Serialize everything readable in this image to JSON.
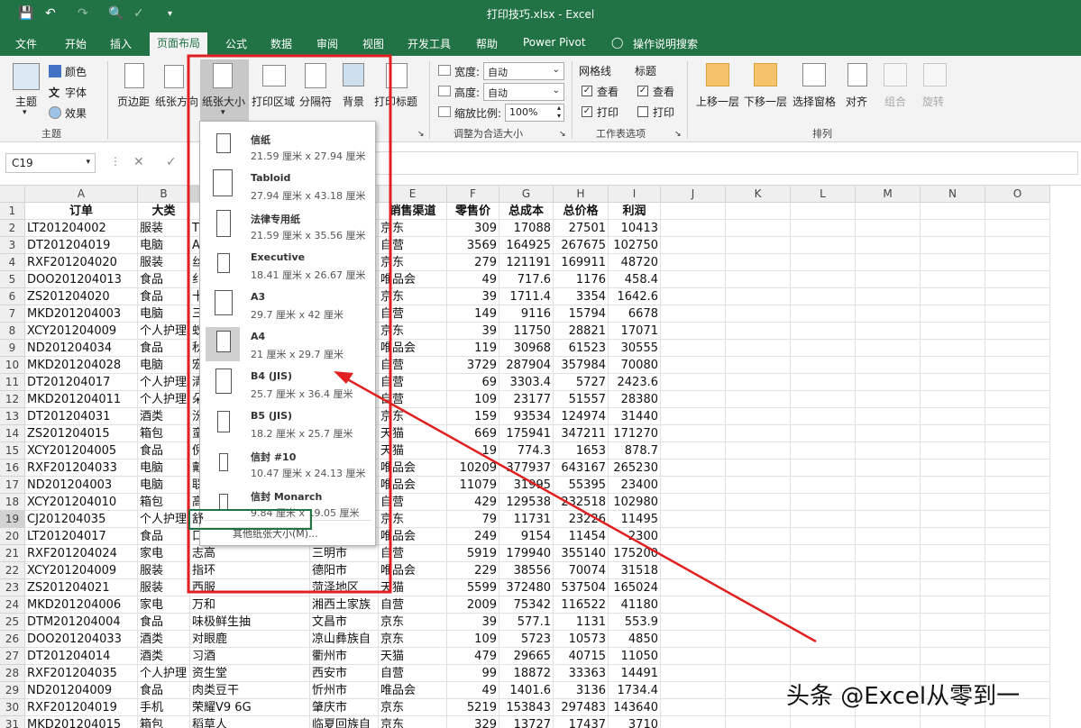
{
  "title_bar": {
    "doc_title": "打印技巧.xlsx",
    "app_name": "Excel",
    "separator": " - "
  },
  "tabs": [
    "文件",
    "开始",
    "插入",
    "页面布局",
    "公式",
    "数据",
    "审阅",
    "视图",
    "开发工具",
    "帮助",
    "Power Pivot",
    "操作说明搜索"
  ],
  "active_tab": "页面布局",
  "ribbon": {
    "theme": {
      "main": "主题",
      "colors": "颜色",
      "fonts": "字体",
      "effects": "效果",
      "group": "主题"
    },
    "page_setup": {
      "margins": "页边距",
      "orientation": "纸张方向",
      "size": "纸张大小",
      "print_area": "打印区域",
      "breaks": "分隔符",
      "background": "背景",
      "print_titles": "打印标题"
    },
    "scale": {
      "width_label": "宽度:",
      "width_value": "自动",
      "height_label": "高度:",
      "height_value": "自动",
      "scale_label": "缩放比例:",
      "scale_value": "100%",
      "group": "调整为合适大小"
    },
    "sheet_options": {
      "gridlines": "网格线",
      "headings": "标题",
      "view": "查看",
      "print": "打印",
      "group": "工作表选项",
      "grid_view": true,
      "grid_print": true,
      "head_view": true,
      "head_print": false
    },
    "arrange": {
      "forward": "上移一层",
      "backward": "下移一层",
      "selection_pane": "选择窗格",
      "align": "对齐",
      "group_btn": "组合",
      "rotate": "旋转",
      "group": "排列"
    }
  },
  "formula_bar": {
    "name_box": "C19",
    "cancel": "✕",
    "enter": "✓"
  },
  "columns": [
    "A",
    "B",
    "C",
    "D",
    "E",
    "F",
    "G",
    "H",
    "I",
    "J",
    "K",
    "L",
    "M",
    "N",
    "O"
  ],
  "rows": [
    [
      "订单",
      "大类",
      "",
      "",
      "销售渠道",
      "零售价",
      "总成本",
      "总价格",
      "利润"
    ],
    [
      "LT201204002",
      "服装",
      "T",
      "",
      "京东",
      "309",
      "17088",
      "27501",
      "10413"
    ],
    [
      "DT201204019",
      "电脑",
      "A",
      "",
      "自营",
      "3569",
      "164925",
      "267675",
      "102750"
    ],
    [
      "RXF201204020",
      "服装",
      "丝",
      "",
      "京东",
      "279",
      "121191",
      "169911",
      "48720"
    ],
    [
      "DOO201204013",
      "食品",
      "纟",
      "",
      "唯品会",
      "49",
      "717.6",
      "1176",
      "458.4"
    ],
    [
      "ZS201204020",
      "食品",
      "十",
      "",
      "京东",
      "39",
      "1711.4",
      "3354",
      "1642.6"
    ],
    [
      "MKD201204003",
      "电脑",
      "三",
      "",
      "自营",
      "149",
      "9116",
      "15794",
      "6678"
    ],
    [
      "XCY201204009",
      "个人护理",
      "蚁",
      "",
      "京东",
      "39",
      "11750",
      "28821",
      "17071"
    ],
    [
      "ND201204034",
      "食品",
      "秋",
      "",
      "唯品会",
      "119",
      "30968",
      "61523",
      "30555"
    ],
    [
      "MKD201204028",
      "电脑",
      "宏",
      "",
      "自营",
      "3729",
      "287904",
      "357984",
      "70080"
    ],
    [
      "DT201204017",
      "个人护理",
      "清",
      "",
      "自营",
      "69",
      "3303.4",
      "5727",
      "2423.6"
    ],
    [
      "MKD201204011",
      "个人护理",
      "朵",
      "",
      "自营",
      "109",
      "23177",
      "51557",
      "28380"
    ],
    [
      "DT201204031",
      "酒类",
      "汾",
      "",
      "京东",
      "159",
      "93534",
      "124974",
      "31440"
    ],
    [
      "ZS201204015",
      "箱包",
      "蛮",
      "",
      "天猫",
      "669",
      "175941",
      "347211",
      "171270"
    ],
    [
      "XCY201204005",
      "食品",
      "倪",
      "",
      "天猫",
      "19",
      "774.3",
      "1653",
      "878.7"
    ],
    [
      "RXF201204033",
      "电脑",
      "戴",
      "",
      "唯品会",
      "10209",
      "377937",
      "643167",
      "265230"
    ],
    [
      "ND201204003",
      "电脑",
      "联",
      "",
      "唯品会",
      "11079",
      "31995",
      "55395",
      "23400"
    ],
    [
      "XCY201204010",
      "箱包",
      "高",
      "",
      "自营",
      "429",
      "129538",
      "232518",
      "102980"
    ],
    [
      "CJ201204035",
      "个人护理",
      "舒",
      "",
      "京东",
      "79",
      "11731",
      "23226",
      "11495"
    ],
    [
      "LT201204017",
      "食品",
      "口",
      "",
      "唯品会",
      "249",
      "9154",
      "11454",
      "2300"
    ],
    [
      "RXF201204024",
      "家电",
      "志高",
      "三明市",
      "自营",
      "5919",
      "179940",
      "355140",
      "175200"
    ],
    [
      "XCY201204009",
      "服装",
      "指环",
      "德阳市",
      "唯品会",
      "229",
      "38556",
      "70074",
      "31518"
    ],
    [
      "ZS201204021",
      "服装",
      "西服",
      "菏泽地区",
      "天猫",
      "5599",
      "372480",
      "537504",
      "165024"
    ],
    [
      "MKD201204006",
      "家电",
      "万和",
      "湘西土家族",
      "自营",
      "2009",
      "75342",
      "116522",
      "41180"
    ],
    [
      "DTM201204004",
      "食品",
      "味极鲜生抽",
      "文昌市",
      "京东",
      "39",
      "577.1",
      "1131",
      "553.9"
    ],
    [
      "DOO201204033",
      "酒类",
      "对眼鹿",
      "凉山彝族自",
      "京东",
      "109",
      "5723",
      "10573",
      "4850"
    ],
    [
      "DT201204014",
      "酒类",
      "习酒",
      "衢州市",
      "天猫",
      "479",
      "29665",
      "40715",
      "11050"
    ],
    [
      "RXF201204035",
      "个人护理",
      "资生堂",
      "西安市",
      "自营",
      "99",
      "18872",
      "33363",
      "14491"
    ],
    [
      "ND201204009",
      "食品",
      "肉类豆干",
      "忻州市",
      "唯品会",
      "49",
      "1401.6",
      "3136",
      "1734.4"
    ],
    [
      "RXF201204019",
      "手机",
      "荣耀V9 6G",
      "肇庆市",
      "京东",
      "5219",
      "153843",
      "297483",
      "143640"
    ],
    [
      "MKD201204015",
      "箱包",
      "稻草人",
      "临夏回族自",
      "京东",
      "329",
      "13727",
      "17437",
      "3710"
    ]
  ],
  "paper_sizes": [
    {
      "name": "信纸",
      "dims": "21.59 厘米 x 27.94 厘米",
      "selected": false
    },
    {
      "name": "Tabloid",
      "dims": "27.94 厘米 x 43.18 厘米",
      "selected": false
    },
    {
      "name": "法律专用纸",
      "dims": "21.59 厘米 x 35.56 厘米",
      "selected": false
    },
    {
      "name": "Executive",
      "dims": "18.41 厘米 x 26.67 厘米",
      "selected": false
    },
    {
      "name": "A3",
      "dims": "29.7 厘米 x 42 厘米",
      "selected": false
    },
    {
      "name": "A4",
      "dims": "21 厘米 x 29.7 厘米",
      "selected": true
    },
    {
      "name": "B4 (JIS)",
      "dims": "25.7 厘米 x 36.4 厘米",
      "selected": false
    },
    {
      "name": "B5 (JIS)",
      "dims": "18.2 厘米 x 25.7 厘米",
      "selected": false
    },
    {
      "name": "信封 #10",
      "dims": "10.47 厘米 x 24.13 厘米",
      "selected": false
    },
    {
      "name": "信封 Monarch",
      "dims": "9.84 厘米 x 19.05 厘米",
      "selected": false
    }
  ],
  "more_sizes": "其他纸张大小(M)...",
  "watermark": "头条 @Excel从零到一",
  "colors": {
    "excel_green": "#217346",
    "annotation_red": "#e02020"
  }
}
